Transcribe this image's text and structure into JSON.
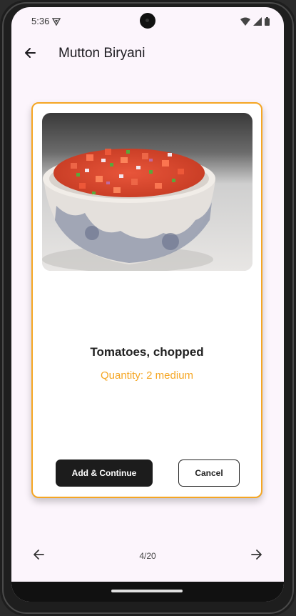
{
  "status_bar": {
    "time": "5:36",
    "icons": [
      "shield-icon",
      "wifi-icon",
      "signal-icon",
      "battery-icon"
    ]
  },
  "app_bar": {
    "title": "Mutton Biryani",
    "back_icon": "arrow-left-icon"
  },
  "card": {
    "image": "bowl of chopped tomatoes",
    "name": "Tomatoes, chopped",
    "quantity": "Quantity: 2 medium",
    "primary_button": "Add & Continue",
    "secondary_button": "Cancel",
    "accent_color": "#f5a623"
  },
  "pager": {
    "indicator": "4/20",
    "prev_icon": "arrow-left-icon",
    "next_icon": "arrow-right-icon"
  },
  "colors": {
    "background": "#fcf5fc",
    "accent": "#f5a623",
    "primary_button": "#1c1c1c"
  }
}
